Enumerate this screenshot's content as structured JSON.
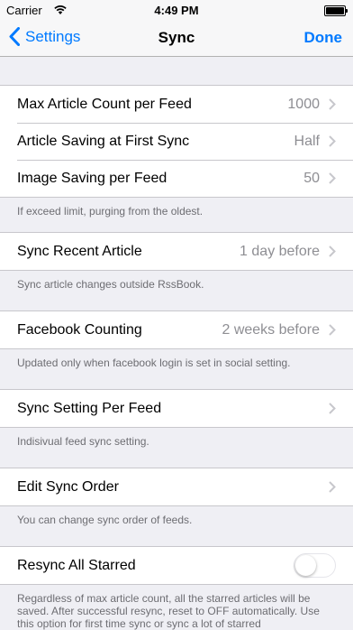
{
  "status": {
    "carrier": "Carrier",
    "time": "4:49 PM"
  },
  "nav": {
    "back": "Settings",
    "title": "Sync",
    "done": "Done"
  },
  "sections": [
    {
      "rows": [
        {
          "label": "Max Article Count per Feed",
          "value": "1000"
        },
        {
          "label": "Article Saving at First Sync",
          "value": "Half"
        },
        {
          "label": "Image Saving per Feed",
          "value": "50"
        }
      ],
      "note": "If exceed limit, purging from the oldest."
    },
    {
      "rows": [
        {
          "label": "Sync Recent Article",
          "value": "1 day before"
        }
      ],
      "note": "Sync article changes outside RssBook."
    },
    {
      "rows": [
        {
          "label": "Facebook Counting",
          "value": "2 weeks before"
        }
      ],
      "note": "Updated only when facebook login is set in social setting."
    },
    {
      "rows": [
        {
          "label": "Sync Setting Per Feed",
          "value": ""
        }
      ],
      "note": "Indisivual feed sync setting."
    },
    {
      "rows": [
        {
          "label": "Edit Sync Order",
          "value": ""
        }
      ],
      "note": "You can change sync order of feeds."
    },
    {
      "rows": [
        {
          "label": "Resync All Starred",
          "toggle": false
        }
      ],
      "note": "Regardless of max article count, all the starred articles will be saved. After successful resync, reset to OFF automatically. Use this option for first time sync or sync a lot of starred"
    }
  ],
  "colors": {
    "accent": "#007aff",
    "background": "#efeff4"
  }
}
